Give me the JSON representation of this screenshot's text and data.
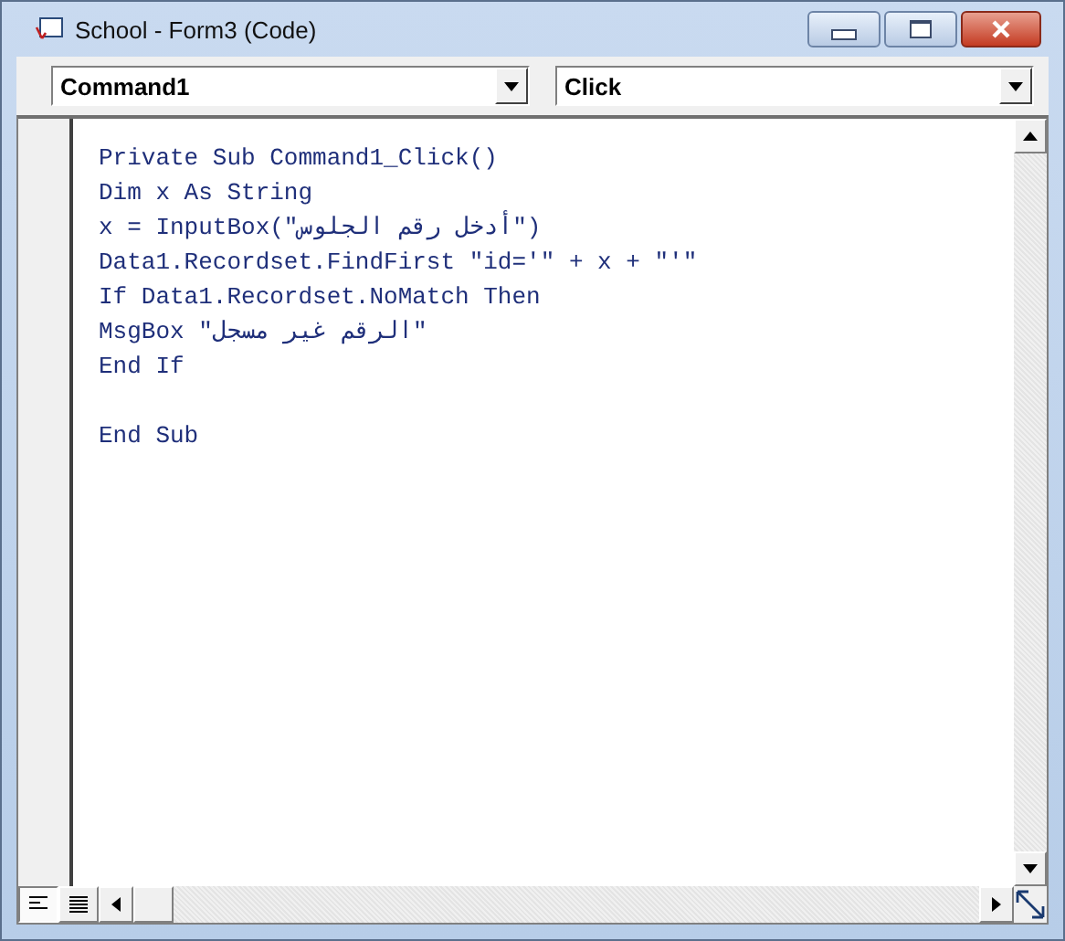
{
  "window": {
    "title": "School - Form3 (Code)"
  },
  "object_combo": {
    "value": "Command1"
  },
  "procedure_combo": {
    "value": "Click"
  },
  "code_lines": [
    {
      "kind": "code",
      "text": "Private Sub Command1_Click()"
    },
    {
      "kind": "code",
      "text": "Dim x As String"
    },
    {
      "kind": "code",
      "text": "x = InputBox(\"أدخل رقم الجلوس\")"
    },
    {
      "kind": "code",
      "text": "Data1.Recordset.FindFirst \"id='\" + x + \"'\""
    },
    {
      "kind": "code",
      "text": "If Data1.Recordset.NoMatch Then"
    },
    {
      "kind": "code",
      "text": "MsgBox \"الرقم غير مسجل\""
    },
    {
      "kind": "code",
      "text": "End If"
    },
    {
      "kind": "blank"
    },
    {
      "kind": "code",
      "text": "End Sub"
    }
  ],
  "view_buttons": [
    {
      "kind": "procedure",
      "selected": true
    },
    {
      "kind": "module",
      "selected": false
    }
  ]
}
